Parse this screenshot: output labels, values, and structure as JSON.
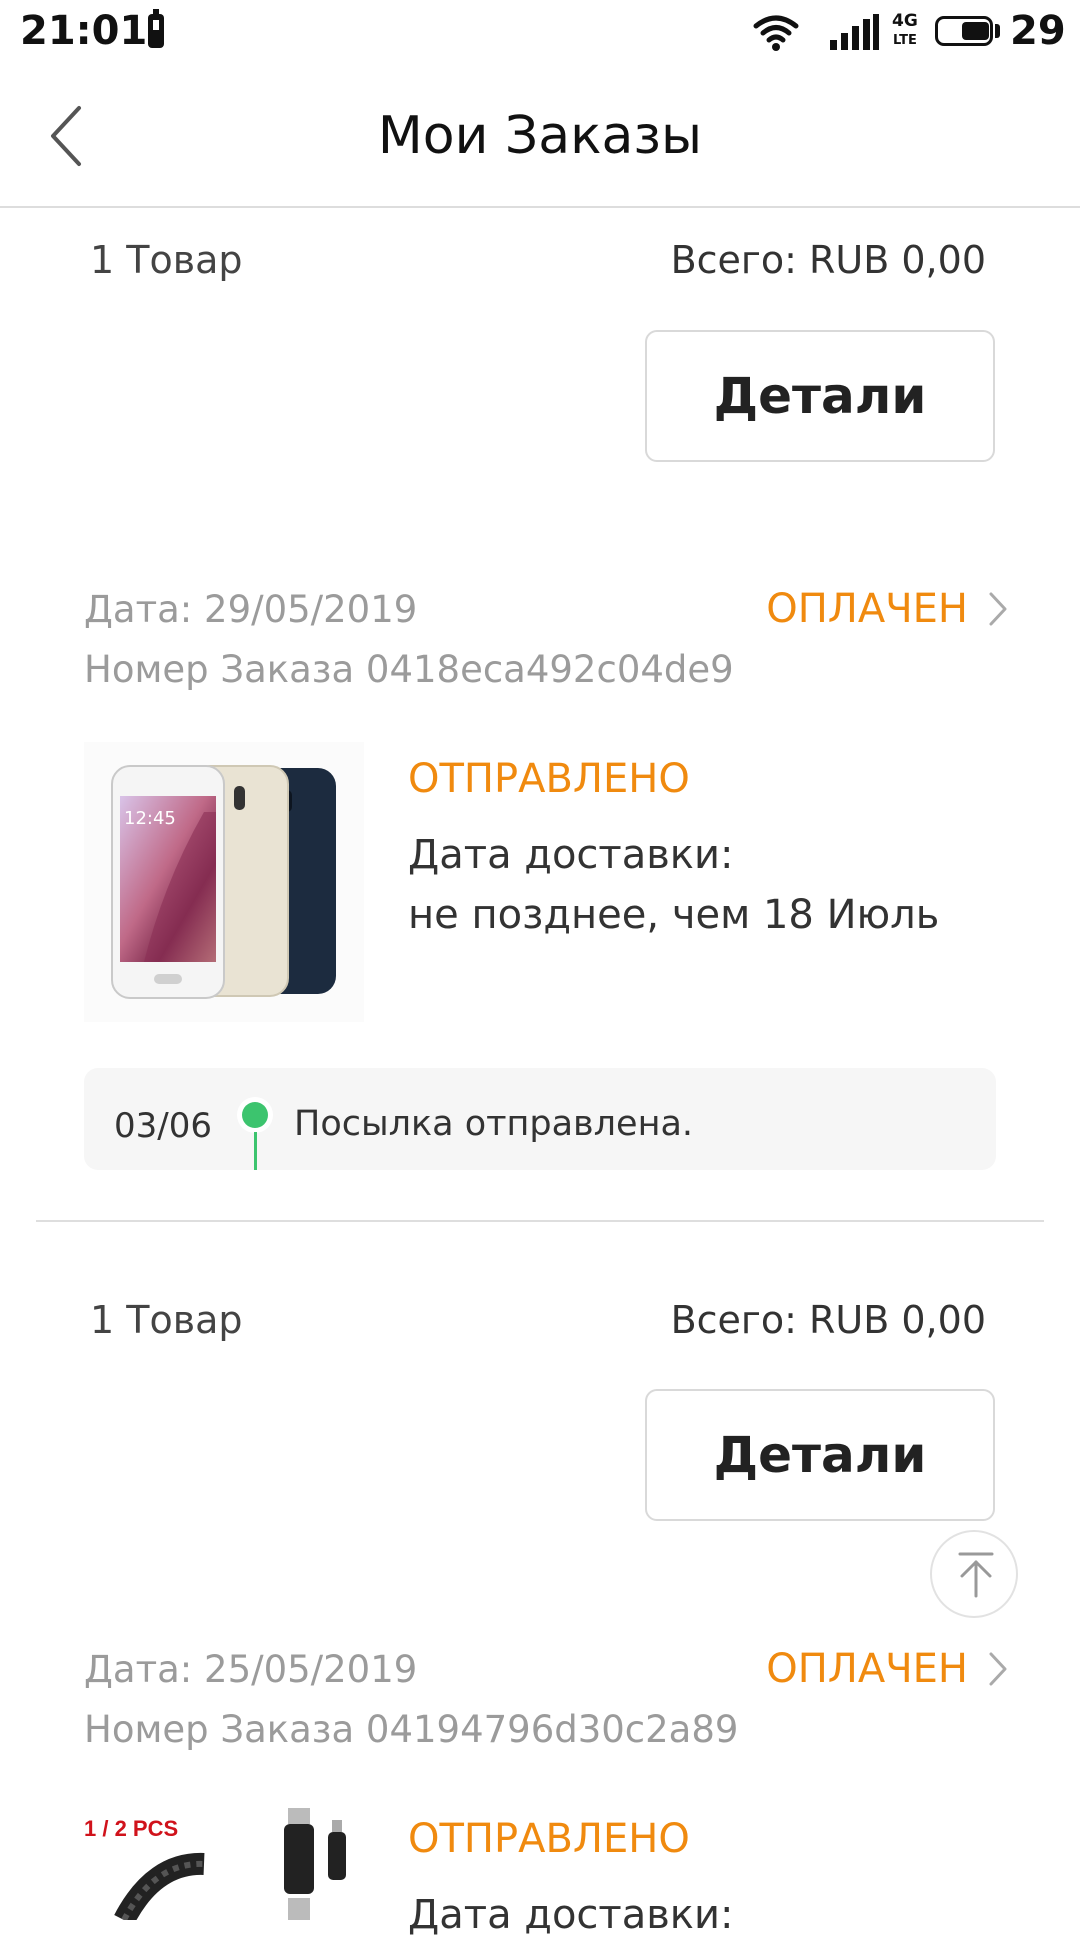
{
  "status_bar": {
    "time": "21:01",
    "network": "4G",
    "network_sub": "LTE",
    "battery_level": "29"
  },
  "header": {
    "title": "Мои Заказы"
  },
  "orders": [
    {
      "items_count": "1 Товар",
      "total": "Всего: RUB 0,00",
      "details_label": "Детали"
    },
    {
      "date": "Дата: 29/05/2019",
      "order_number": "Номер Заказа 0418eca492c04de9",
      "status": "ОПЛАЧЕН",
      "shipping_status": "ОТПРАВЛЕНО",
      "delivery_label": "Дата доставки:",
      "delivery_value": "не позднее, чем 18 Июль",
      "tracking": {
        "date": "03/06",
        "text": "Посылка отправлена."
      },
      "items_count": "1 Товар",
      "total": "Всего: RUB 0,00",
      "details_label": "Детали"
    },
    {
      "date": "Дата: 25/05/2019",
      "order_number": "Номер Заказа 04194796d30c2a89",
      "status": "ОПЛАЧЕН",
      "shipping_status": "ОТПРАВЛЕНО",
      "delivery_label": "Дата доставки:",
      "product_badge": "1 / 2 PCS"
    }
  ],
  "icons": {
    "back": "chevron-left-icon",
    "status_arrow": "chevron-right-icon",
    "scroll_top": "arrow-up-to-top-icon"
  },
  "colors": {
    "accent": "#f08a0f",
    "tracking_dot": "#3cc46e",
    "muted_text": "#9b9b9b"
  }
}
